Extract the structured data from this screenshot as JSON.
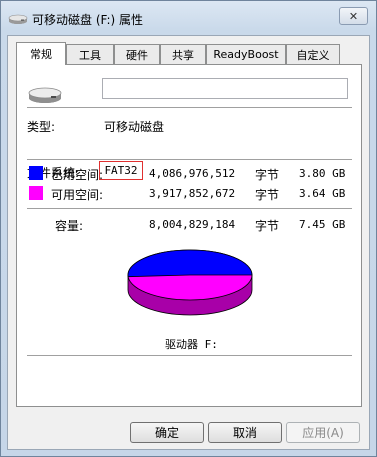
{
  "window": {
    "title": "可移动磁盘 (F:) 属性",
    "close_glyph": "✕"
  },
  "tabs": [
    {
      "label": "常规",
      "active": true
    },
    {
      "label": "工具",
      "active": false
    },
    {
      "label": "硬件",
      "active": false
    },
    {
      "label": "共享",
      "active": false
    },
    {
      "label": "ReadyBoost",
      "active": false
    },
    {
      "label": "自定义",
      "active": false
    }
  ],
  "general": {
    "volume_name": "",
    "type_label": "类型:",
    "type_value": "可移动磁盘",
    "fs_label": "文件系统:",
    "fs_value": "FAT32",
    "used": {
      "label": "已用空间:",
      "bytes": "4,086,976,512",
      "unit": "字节",
      "size": "3.80 GB",
      "color": "#0000ff"
    },
    "free": {
      "label": "可用空间:",
      "bytes": "3,917,852,672",
      "unit": "字节",
      "size": "3.64 GB",
      "color": "#ff00ff"
    },
    "capacity": {
      "label": "容量:",
      "bytes": "8,004,829,184",
      "unit": "字节",
      "size": "7.45 GB"
    },
    "drive_caption": "驱动器 F:",
    "used_fraction": 0.5106
  },
  "buttons": {
    "ok": "确定",
    "cancel": "取消",
    "apply": "应用(A)"
  },
  "icons": {
    "title": "removable-drive-icon",
    "drive": "removable-drive-icon",
    "close": "close-icon"
  }
}
